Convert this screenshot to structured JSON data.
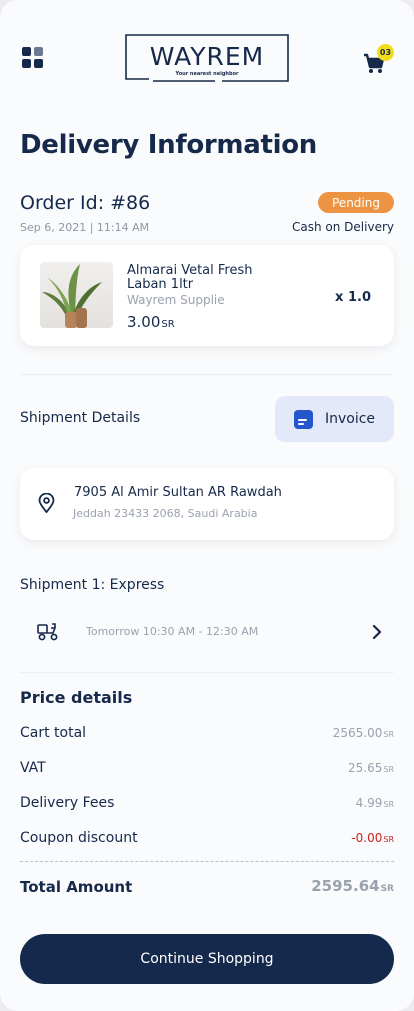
{
  "header": {
    "logo_text": "WAYREM",
    "logo_tagline": "Your nearest neighbor",
    "cart_count": "03"
  },
  "page": {
    "title": "Delivery Information"
  },
  "order": {
    "id_label": "Order Id: #86",
    "date": "Sep 6, 2021 | 11:14 AM",
    "status": "Pending",
    "payment_method": "Cash on Delivery"
  },
  "product": {
    "name": "Almarai Vetal Fresh Laban 1ltr",
    "supplier": "Wayrem Supplie",
    "price": "3.00",
    "currency": "SR",
    "quantity": "x 1.0"
  },
  "shipment": {
    "details_label": "Shipment Details",
    "invoice_label": "Invoice",
    "address_line1": "7905 Al Amir Sultan AR Rawdah",
    "address_line2": "Jeddah 23433 2068, Saudi Arabia",
    "method_title": "Shipment 1: Express",
    "time_window": "Tomorrow 10:30 AM - 12:30 AM"
  },
  "price_details": {
    "title": "Price details",
    "currency": "SR",
    "rows": [
      {
        "label": "Cart total",
        "value": "2565.00"
      },
      {
        "label": "VAT",
        "value": "25.65"
      },
      {
        "label": "Delivery Fees",
        "value": "4.99"
      },
      {
        "label": "Coupon discount",
        "value": "-0.00"
      }
    ],
    "total_label": "Total Amount",
    "total_value": "2595.64"
  },
  "actions": {
    "continue_label": "Continue Shopping"
  },
  "colors": {
    "primary": "#14294b",
    "pending": "#ed9443",
    "invoice_bg": "#e3e9f8",
    "invoice_icon": "#2457cc",
    "badge": "#f2dc1e",
    "discount": "#c8231e"
  }
}
